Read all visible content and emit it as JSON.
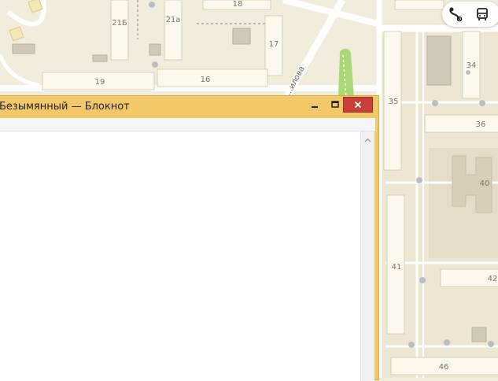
{
  "map": {
    "buildings": [
      "21Б",
      "21а",
      "18",
      "17",
      "19",
      "16",
      "35",
      "34",
      "36",
      "40",
      "41",
      "42",
      "46"
    ],
    "street": "...илова"
  },
  "map_controls": {
    "route_icon": "route-icon",
    "transit_icon": "bus-icon"
  },
  "notepad": {
    "title": "Безымянный — Блокнот",
    "content": "",
    "buttons": {
      "minimize": "minimize-icon",
      "maximize": "maximize-icon",
      "close": "close-icon"
    }
  },
  "colors": {
    "map_bg": "#f1ecdb",
    "building": "#fbf8ee",
    "road": "#ffffff",
    "park": "#a9d876",
    "window_frame": "#f3c869",
    "close_button": "#c9403a"
  }
}
